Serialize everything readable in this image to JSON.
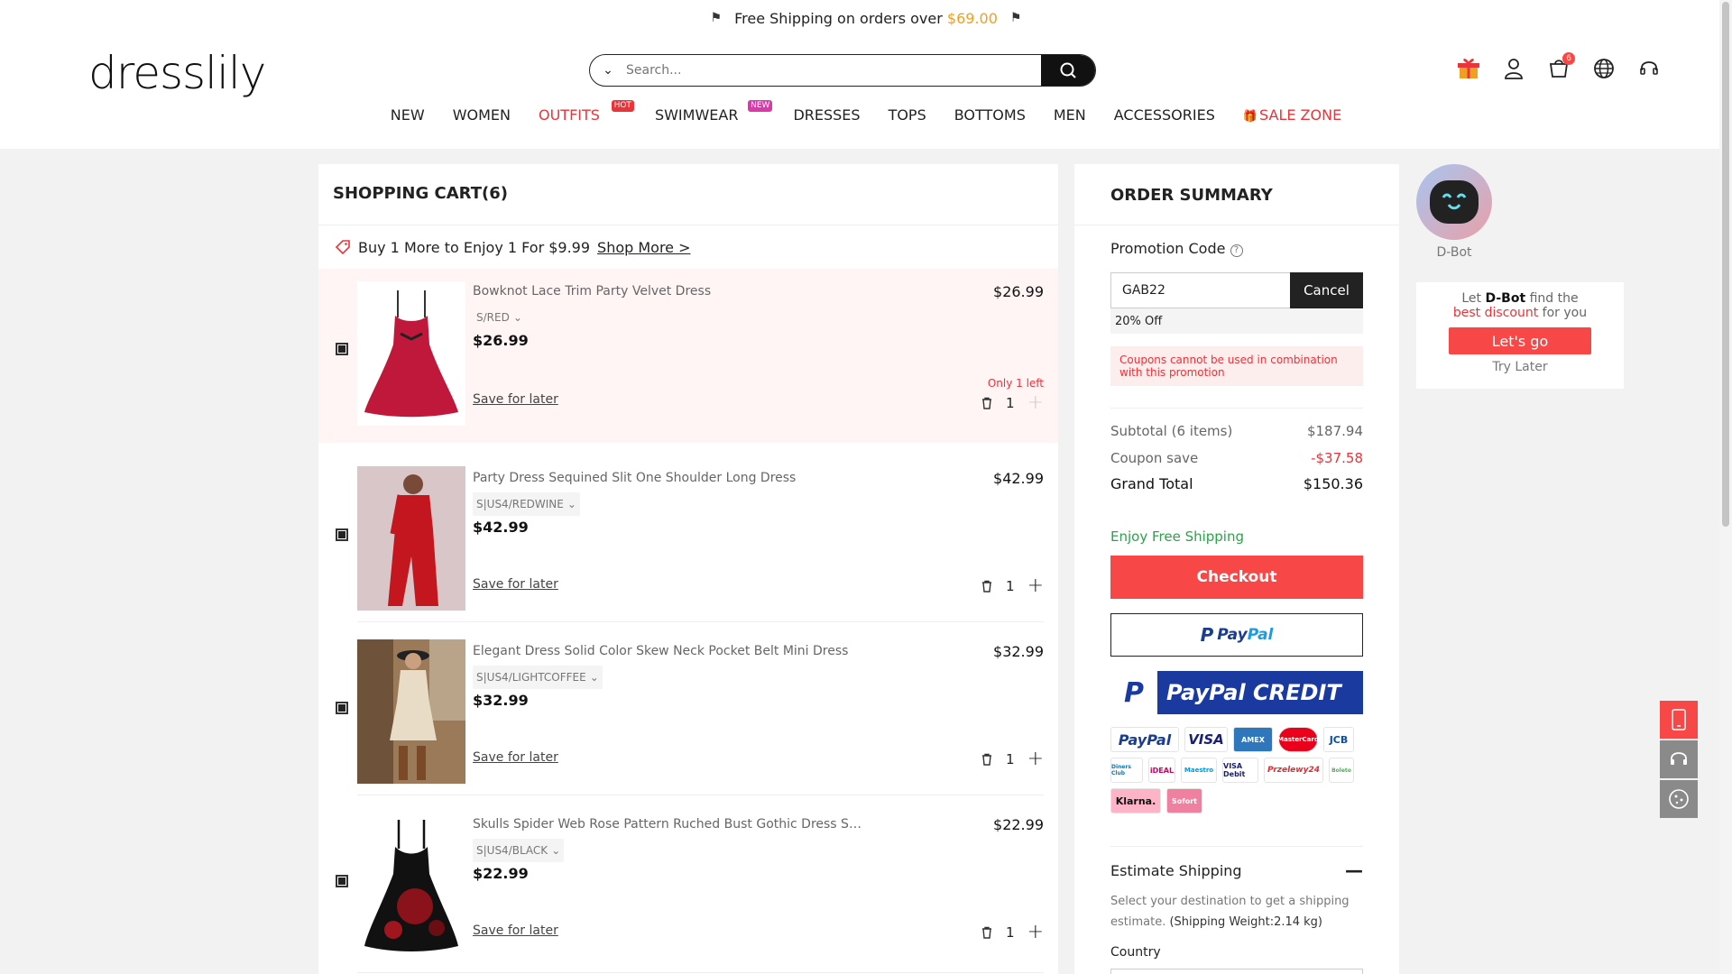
{
  "banner": {
    "text": "Free Shipping on orders over",
    "amount": "$69.00"
  },
  "header": {
    "logo": "dresslily",
    "search_placeholder": "Search...",
    "cart_count": "6",
    "nav": [
      {
        "label": "NEW"
      },
      {
        "label": "WOMEN"
      },
      {
        "label": "OUTFITS",
        "tag": "HOT"
      },
      {
        "label": "SWIMWEAR",
        "tag": "NEW"
      },
      {
        "label": "DRESSES"
      },
      {
        "label": "TOPS"
      },
      {
        "label": "BOTTOMS"
      },
      {
        "label": "MEN"
      },
      {
        "label": "ACCESSORIES"
      },
      {
        "label": "SALE ZONE"
      }
    ]
  },
  "cart": {
    "title": "SHOPPING CART(6)",
    "promo_text": "Buy 1 More to Enjoy 1 For $9.99",
    "promo_link": "Shop More >",
    "save_label": "Save for later",
    "only_left": "Only 1 left",
    "items": [
      {
        "name": "Bowknot Lace Trim Party Velvet Dress",
        "variant": "S/RED",
        "price": "$26.99",
        "subtotal": "$26.99",
        "qty": "1"
      },
      {
        "name": "Party Dress Sequined Slit One Shoulder Long Dress",
        "variant": "S|US4/REDWINE",
        "price": "$42.99",
        "subtotal": "$42.99",
        "qty": "1"
      },
      {
        "name": "Elegant Dress Solid Color Skew Neck Pocket Belt Mini Dress",
        "variant": "S|US4/LIGHTCOFFEE",
        "price": "$32.99",
        "subtotal": "$32.99",
        "qty": "1"
      },
      {
        "name": "Skulls Spider Web Rose Pattern Ruched Bust Gothic Dress Sw...",
        "variant": "S|US4/BLACK",
        "price": "$22.99",
        "subtotal": "$22.99",
        "qty": "1"
      }
    ]
  },
  "summary": {
    "title": "ORDER SUMMARY",
    "promo_label": "Promotion Code",
    "code_value": "GAB22",
    "cancel_label": "Cancel",
    "discount_tag": "20% Off",
    "warning": "Coupons cannot be used in combination with this promotion",
    "subtotal_label": "Subtotal (6 items)",
    "subtotal_value": "$187.94",
    "coupon_label": "Coupon save",
    "coupon_value": "-$37.58",
    "grand_label": "Grand Total",
    "grand_value": "$150.36",
    "free_shipping": "Enjoy Free Shipping",
    "checkout_label": "Checkout",
    "paypal_pay": "Pay",
    "paypal_pal": "Pal",
    "paypal_credit": "PayPal CREDIT",
    "payment_methods": [
      "PayPal",
      "VISA",
      "AMEX",
      "MasterCard",
      "JCB",
      "Diners Club",
      "iDEAL",
      "Maestro",
      "VISA Debit",
      "Przelewy24",
      "Boleto",
      "Klarna.",
      "Sofort"
    ],
    "estimate_title": "Estimate Shipping",
    "estimate_desc": "Select your destination to get a shipping estimate.",
    "estimate_weight": "(Shipping Weight:2.14 kg)",
    "country_label": "Country"
  },
  "dbot": {
    "name": "D-Bot",
    "line1_a": "Let",
    "line1_b": "D-Bot",
    "line1_c": "find the",
    "line2_a": "best discount",
    "line2_b": "for you",
    "go_label": "Let's go",
    "later_label": "Try Later"
  },
  "colors": {
    "accent_red": "#f74747",
    "sale_red": "#e8343b",
    "free_green": "#2ca24a",
    "amount_orange": "#f0a020"
  }
}
